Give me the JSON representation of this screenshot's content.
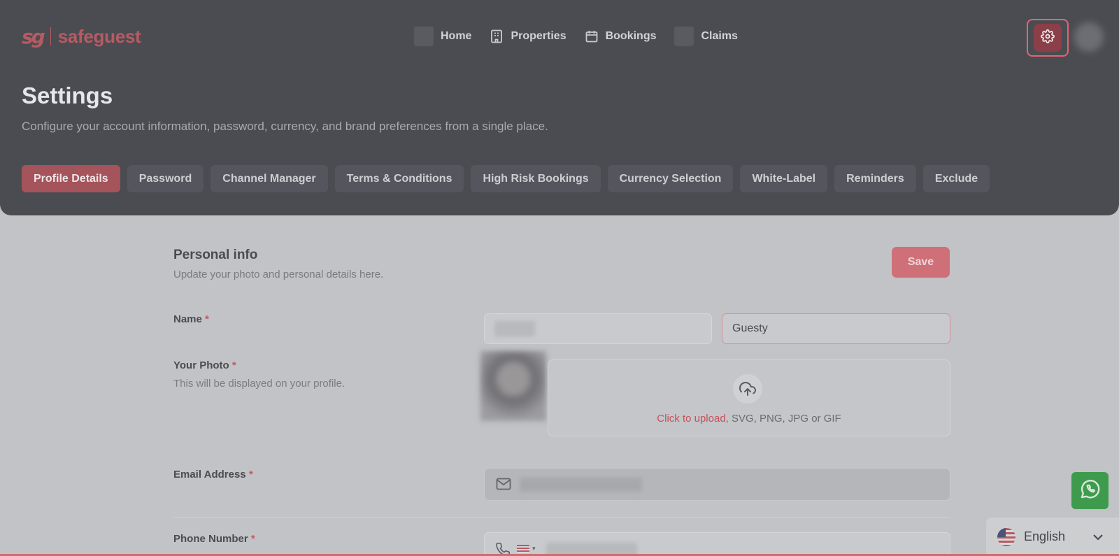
{
  "brand": {
    "mark": "sg",
    "name": "safeguest",
    "color": "#b65b62"
  },
  "nav": {
    "items": [
      {
        "label": "Home",
        "icon": "home-icon"
      },
      {
        "label": "Properties",
        "icon": "building-icon"
      },
      {
        "label": "Bookings",
        "icon": "calendar-icon"
      },
      {
        "label": "Claims",
        "icon": "claims-icon"
      }
    ]
  },
  "header": {
    "title": "Settings",
    "subtitle": "Configure your account information, password, currency, and brand preferences from a single place."
  },
  "tabs": [
    {
      "label": "Profile Details",
      "active": true
    },
    {
      "label": "Password"
    },
    {
      "label": "Channel Manager"
    },
    {
      "label": "Terms & Conditions"
    },
    {
      "label": "High Risk Bookings"
    },
    {
      "label": "Currency Selection"
    },
    {
      "label": "White-Label"
    },
    {
      "label": "Reminders"
    },
    {
      "label": "Exclude"
    }
  ],
  "personal_info": {
    "title": "Personal info",
    "subtitle": "Update your photo and personal details here.",
    "save_label": "Save"
  },
  "fields": {
    "name": {
      "label": "Name",
      "required_mark": "*",
      "last_name": "Guesty"
    },
    "photo": {
      "label": "Your Photo",
      "required_mark": "*",
      "help": "This will be displayed on your profile.",
      "upload_link": "Click to upload,",
      "upload_formats": " SVG, PNG, JPG or GIF"
    },
    "email": {
      "label": "Email Address",
      "required_mark": "*"
    },
    "phone": {
      "label": "Phone Number",
      "required_mark": "*"
    }
  },
  "language": {
    "selected": "English"
  },
  "colors": {
    "accent": "#e5646f",
    "whatsapp": "#3e9b4d"
  }
}
